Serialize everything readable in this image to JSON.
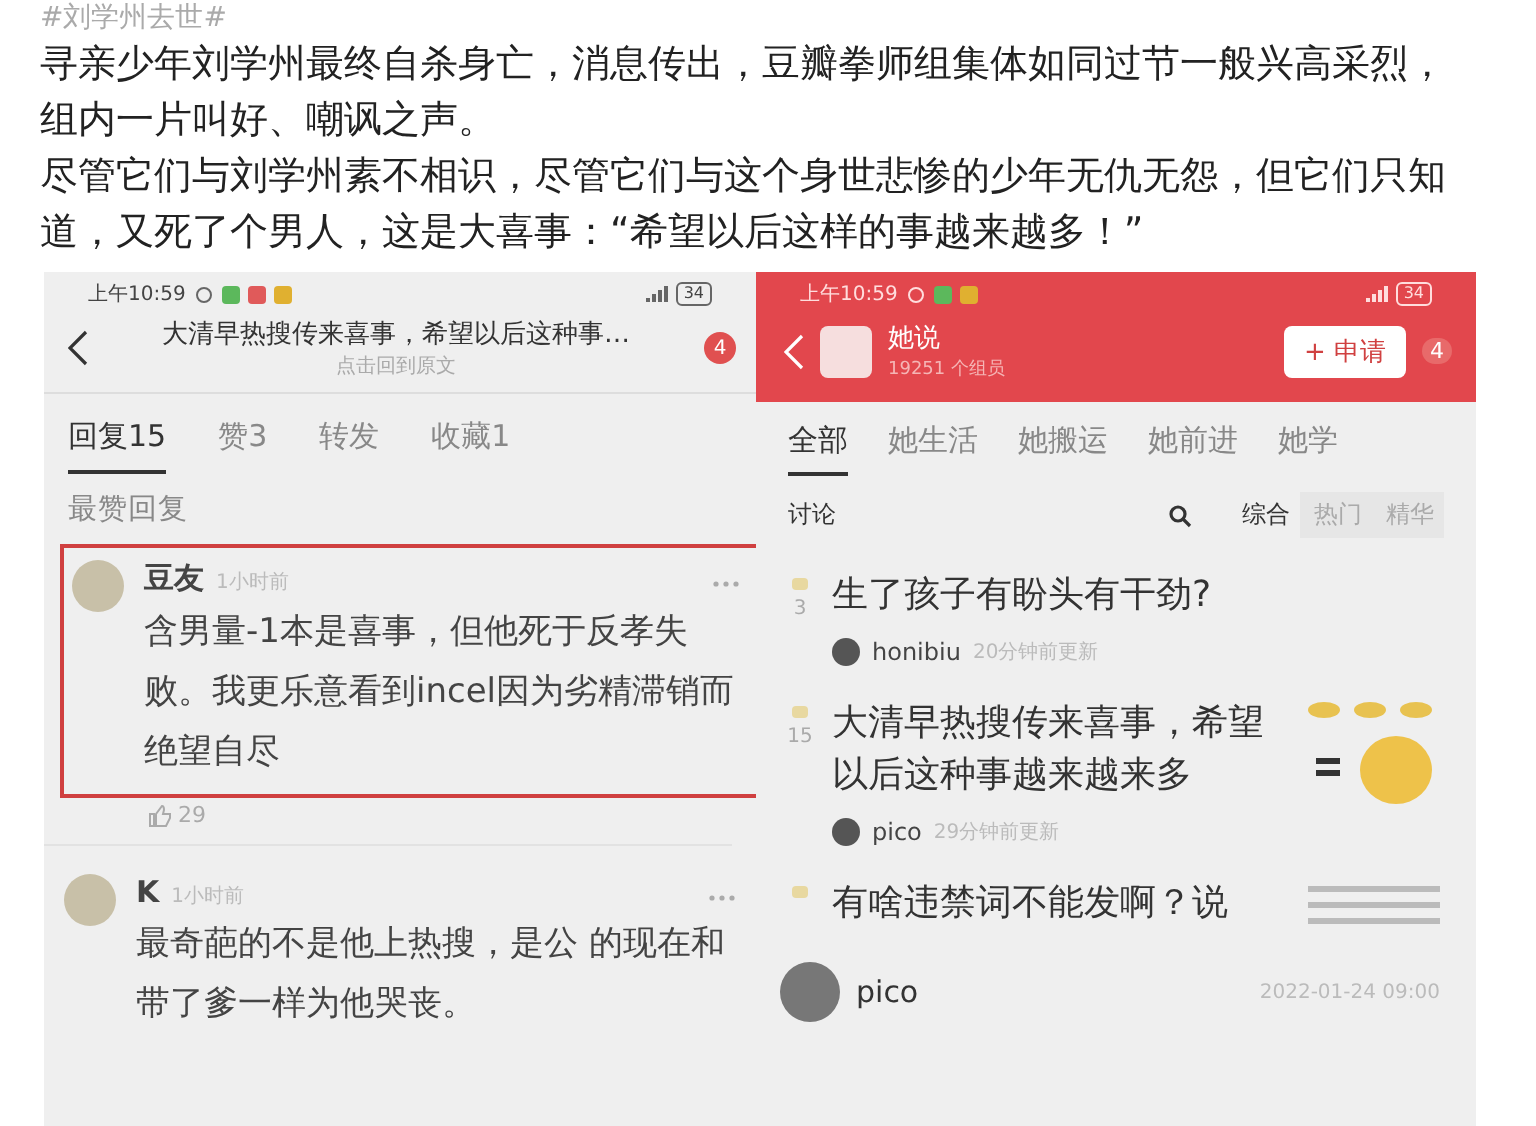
{
  "hashtag": "#刘学州去世#",
  "paragraphs": [
    "寻亲少年刘学州最终自杀身亡，消息传出，豆瓣拳师组集体如同过节一般兴高采烈，组内一片叫好、嘲讽之声。",
    "尽管它们与刘学州素不相识，尽管它们与这个身世悲惨的少年无仇无怨，但它们只知道，又死了个男人，这是大喜事：“希望以后这样的事越来越多！”"
  ],
  "left_screen": {
    "status_time": "上午10:59",
    "battery": "34",
    "header_title": "大清早热搜传来喜事，希望以后这种事…",
    "header_subtitle": "点击回到原文",
    "badge": "4",
    "tabs": [
      {
        "label": "回复",
        "count": "15",
        "selected": true
      },
      {
        "label": "赞",
        "count": "3",
        "selected": false
      },
      {
        "label": "转发",
        "selected": false
      },
      {
        "label": "收藏",
        "count": "1",
        "selected": false
      }
    ],
    "section_title": "最赞回复",
    "comments": [
      {
        "author": "豆友",
        "time": "1小时前",
        "text": "含男量-1本是喜事，但他死于反孝失败。我更乐意看到incel因为劣精滞销而绝望自尽",
        "highlighted": true,
        "likes": "29"
      },
      {
        "author": "K",
        "time": "1小时前",
        "text": "最奇葩的不是他上热搜，是公 的现在和带了爹一样为他哭丧。",
        "highlighted": false
      }
    ]
  },
  "right_screen": {
    "status_time": "上午10:59",
    "battery": "34",
    "group_name": "她说",
    "member_count": "19251 个组员",
    "join_button": "+ 申请",
    "badge": "4",
    "tabs": [
      {
        "label": "全部",
        "selected": true
      },
      {
        "label": "她生活",
        "selected": false
      },
      {
        "label": "她搬运",
        "selected": false
      },
      {
        "label": "她前进",
        "selected": false
      },
      {
        "label": "她学",
        "selected": false
      }
    ],
    "filter_label": "讨论",
    "sort_options": [
      {
        "label": "综合",
        "selected": true
      },
      {
        "label": "热门",
        "selected": false
      },
      {
        "label": "精华",
        "selected": false
      }
    ],
    "posts": [
      {
        "title": "生了孩子有盼头有干劲?",
        "count": "3",
        "author": "honibiu",
        "updated": "20分钟前更新",
        "kind": "plain"
      },
      {
        "title": "大清早热搜传来喜事，希望以后这种事越来越来多",
        "count": "15",
        "author": "pico",
        "updated": "29分钟前更新",
        "kind": "meme"
      },
      {
        "title": "有啥违禁词不能发啊？说",
        "kind": "text"
      }
    ],
    "footer_author": "pico",
    "footer_date": "2022-01-24 09:00"
  }
}
